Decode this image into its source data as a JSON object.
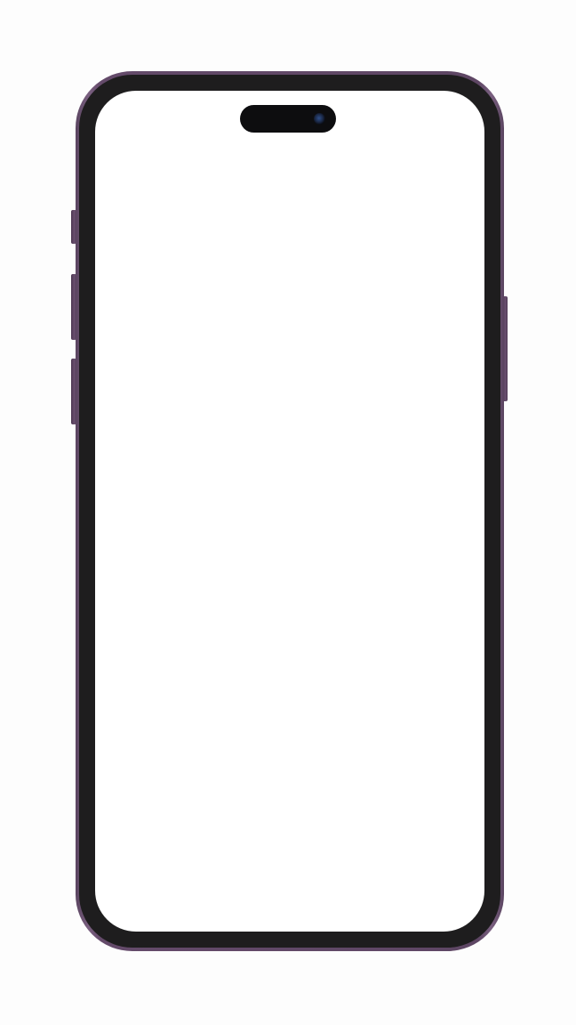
{
  "device": {
    "frame_color": "#6b5170",
    "bezel_color": "#1e1d1e",
    "screen_color": "#ffffff",
    "background_color": "#fdfdfd"
  },
  "icons": {
    "front_camera": "camera-lens-icon"
  },
  "screen": {
    "content": ""
  }
}
